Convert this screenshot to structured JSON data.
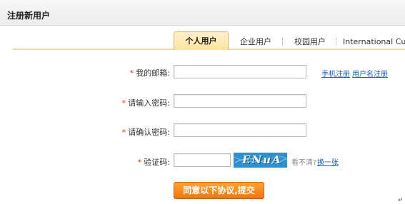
{
  "header": {
    "title": "注册新用户"
  },
  "tabs": [
    {
      "label": "个人用户",
      "active": true
    },
    {
      "label": "企业用户",
      "active": false
    },
    {
      "label": "校园用户",
      "active": false
    },
    {
      "label": "International Cus",
      "active": false
    }
  ],
  "form": {
    "required_mark": "*",
    "email_label": "我的邮箱:",
    "email_value": "",
    "password_label": "请输入密码:",
    "password_value": "",
    "confirm_label": "请确认密码:",
    "confirm_value": "",
    "captcha_label": "验证码:",
    "captcha_value": "",
    "captcha_image_text": "ENuA",
    "unclear_hint": "看不清?",
    "refresh_link": "换一张"
  },
  "links": {
    "phone_register": "手机注册",
    "username_register": "用户名注册"
  },
  "submit": {
    "label": "同意以下协议,提交"
  },
  "footer": {
    "return_glyph": "↵"
  },
  "colors": {
    "accent": "#f0750a",
    "tab_active": "#ffe3a0",
    "link": "#1a5fb4",
    "required": "#d9302a"
  }
}
